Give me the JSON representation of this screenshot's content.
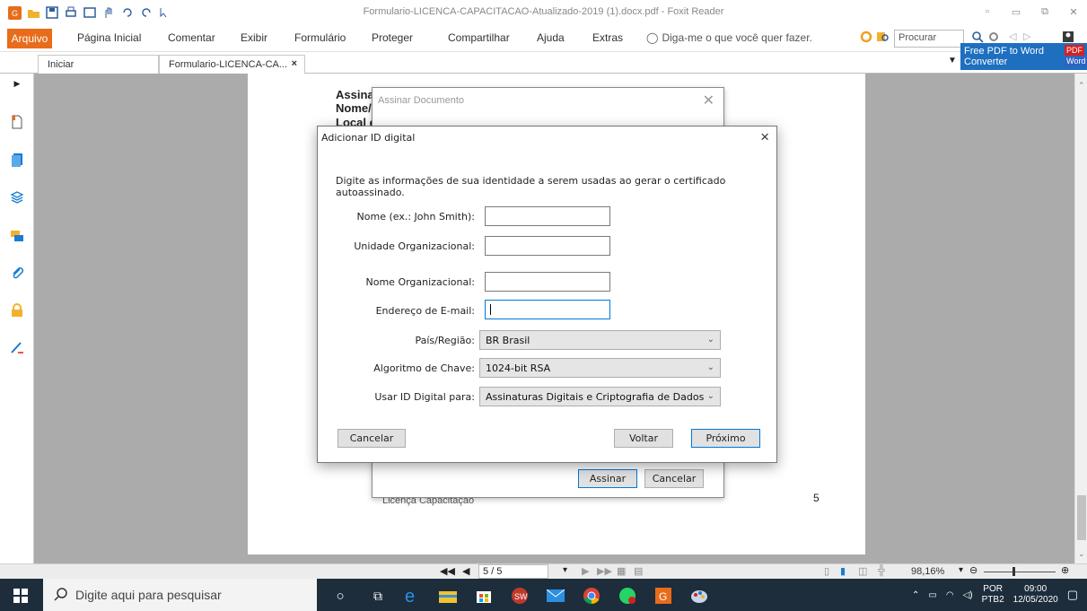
{
  "window": {
    "title": "Formulario-LICENCA-CAPACITACAO-Atualizado-2019 (1).docx.pdf - Foxit Reader"
  },
  "ribbon": {
    "tabs": [
      "Página Inicial",
      "Comentar",
      "Exibir",
      "Formulário",
      "Proteger",
      "Compartilhar",
      "Ajuda",
      "Extras"
    ],
    "file_tab": "Arquivo",
    "tell_me": "Diga-me o que você quer fazer.",
    "search_placeholder": "Procurar",
    "promo_line1": "Free PDF to Word",
    "promo_line2": "Converter",
    "promo_badge1": "PDF",
    "promo_badge2": "Word"
  },
  "doc_tabs": {
    "start": "Iniciar",
    "file": "Formulario-LICENCA-CA...",
    "close": "×"
  },
  "page": {
    "line1": "Assinat",
    "line2": "Nome/(",
    "line3": "Local e",
    "footer": "Licença Capacitação",
    "number": "5"
  },
  "back_dialog": {
    "title": "Assinar Documento",
    "sign_button": "Assinar",
    "cancel_button": "Cancelar"
  },
  "dialog": {
    "title": "Adicionar ID digital",
    "description": "Digite as informações de sua identidade a serem usadas ao gerar o certificado autoassinado.",
    "fields": {
      "name_label": "Nome (ex.: John Smith):",
      "name_value": "",
      "org_unit_label": "Unidade Organizacional:",
      "org_unit_value": "",
      "org_name_label": "Nome Organizacional:",
      "org_name_value": "",
      "email_label": "Endereço de E-mail:",
      "email_value": "",
      "country_label": "País/Região:",
      "country_value": "BR Brasil",
      "algorithm_label": "Algoritmo de Chave:",
      "algorithm_value": "1024-bit RSA",
      "usage_label": "Usar ID Digital para:",
      "usage_value": "Assinaturas Digitais e Criptografia de Dados"
    },
    "buttons": {
      "cancel": "Cancelar",
      "back": "Voltar",
      "next": "Próximo"
    },
    "close": "×"
  },
  "statusbar": {
    "page_indicator": "5 / 5",
    "zoom": "98,16%"
  },
  "taskbar": {
    "search_placeholder": "Digite aqui para pesquisar",
    "lang1": "POR",
    "lang2": "PTB2",
    "time": "09:00",
    "date": "12/05/2020"
  },
  "colors": {
    "accent_orange": "#e86c1b",
    "focus_blue": "#0078d7",
    "taskbar": "#1d2d3c"
  }
}
